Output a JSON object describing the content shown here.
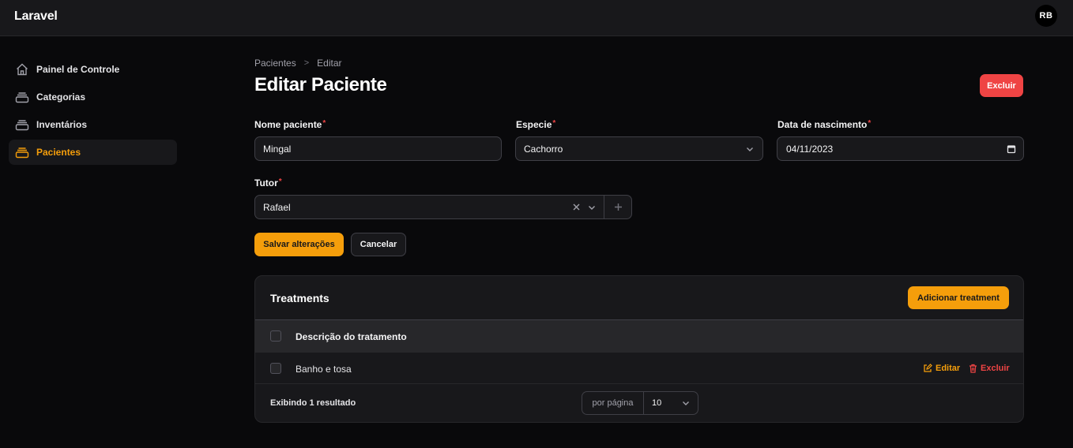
{
  "app": {
    "brand": "Laravel",
    "avatar_initials": "RB"
  },
  "sidebar": {
    "items": [
      {
        "label": "Painel de Controle",
        "icon": "home-icon",
        "active": false
      },
      {
        "label": "Categorias",
        "icon": "collection-icon",
        "active": false
      },
      {
        "label": "Inventários",
        "icon": "collection-icon",
        "active": false
      },
      {
        "label": "Pacientes",
        "icon": "collection-icon",
        "active": true
      }
    ]
  },
  "breadcrumb": {
    "parent": "Pacientes",
    "separator": ">",
    "current": "Editar"
  },
  "page": {
    "title": "Editar Paciente",
    "delete_label": "Excluir"
  },
  "form": {
    "nome": {
      "label": "Nome paciente",
      "required": "*",
      "value": "Mingal"
    },
    "especie": {
      "label": "Especie",
      "required": "*",
      "value": "Cachorro"
    },
    "nascimento": {
      "label": "Data de nascimento",
      "required": "*",
      "value": "04/11/2023"
    },
    "tutor": {
      "label": "Tutor",
      "required": "*",
      "value": "Rafael"
    },
    "save_label": "Salvar alterações",
    "cancel_label": "Cancelar"
  },
  "treatments": {
    "title": "Treatments",
    "add_label": "Adicionar treatment",
    "column_header": "Descrição do tratamento",
    "rows": [
      {
        "description": "Banho e tosa",
        "edit_label": "Editar",
        "delete_label": "Excluir"
      }
    ],
    "footer": {
      "summary": "Exibindo 1 resultado",
      "per_page_label": "por página",
      "per_page_value": "10"
    }
  },
  "colors": {
    "accent": "#f59e0b",
    "danger": "#ef4444",
    "background": "#09090b",
    "surface": "#18181b"
  }
}
